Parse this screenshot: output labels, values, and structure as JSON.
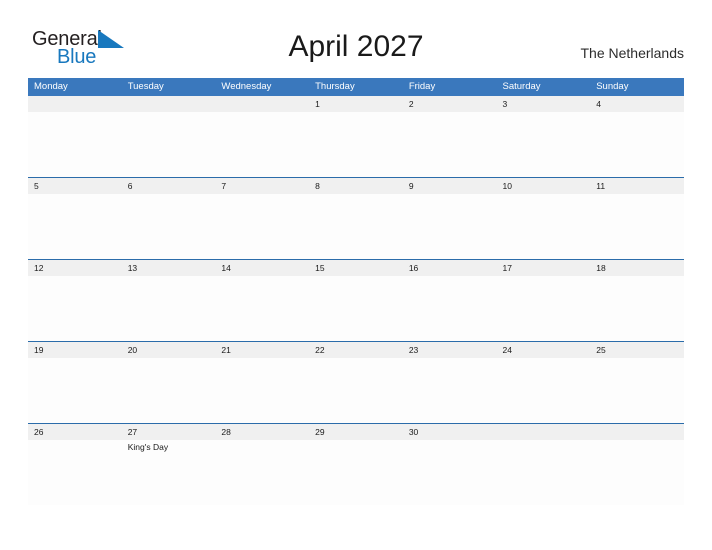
{
  "brand": {
    "name_part1": "General",
    "name_part2": "Blue",
    "flag_icon": "blue-triangle-flag",
    "dark_color": "#231f20",
    "blue_color": "#1878be"
  },
  "header": {
    "title": "April 2027",
    "country": "The Netherlands"
  },
  "theme": {
    "header_blue": "#3a78bd",
    "row_line_blue": "#2b6caa",
    "date_band_gray": "#f0f0f0",
    "page_background": "#ffffff"
  },
  "calendar": {
    "month": "April",
    "year": "2027",
    "week_start": "Monday",
    "weekdays": [
      "Monday",
      "Tuesday",
      "Wednesday",
      "Thursday",
      "Friday",
      "Saturday",
      "Sunday"
    ],
    "weeks": [
      {
        "days": [
          {
            "date": "",
            "event": ""
          },
          {
            "date": "",
            "event": ""
          },
          {
            "date": "",
            "event": ""
          },
          {
            "date": "1",
            "event": ""
          },
          {
            "date": "2",
            "event": ""
          },
          {
            "date": "3",
            "event": ""
          },
          {
            "date": "4",
            "event": ""
          }
        ]
      },
      {
        "days": [
          {
            "date": "5",
            "event": ""
          },
          {
            "date": "6",
            "event": ""
          },
          {
            "date": "7",
            "event": ""
          },
          {
            "date": "8",
            "event": ""
          },
          {
            "date": "9",
            "event": ""
          },
          {
            "date": "10",
            "event": ""
          },
          {
            "date": "11",
            "event": ""
          }
        ]
      },
      {
        "days": [
          {
            "date": "12",
            "event": ""
          },
          {
            "date": "13",
            "event": ""
          },
          {
            "date": "14",
            "event": ""
          },
          {
            "date": "15",
            "event": ""
          },
          {
            "date": "16",
            "event": ""
          },
          {
            "date": "17",
            "event": ""
          },
          {
            "date": "18",
            "event": ""
          }
        ]
      },
      {
        "days": [
          {
            "date": "19",
            "event": ""
          },
          {
            "date": "20",
            "event": ""
          },
          {
            "date": "21",
            "event": ""
          },
          {
            "date": "22",
            "event": ""
          },
          {
            "date": "23",
            "event": ""
          },
          {
            "date": "24",
            "event": ""
          },
          {
            "date": "25",
            "event": ""
          }
        ]
      },
      {
        "days": [
          {
            "date": "26",
            "event": ""
          },
          {
            "date": "27",
            "event": "King's Day"
          },
          {
            "date": "28",
            "event": ""
          },
          {
            "date": "29",
            "event": ""
          },
          {
            "date": "30",
            "event": ""
          },
          {
            "date": "",
            "event": ""
          },
          {
            "date": "",
            "event": ""
          }
        ]
      }
    ]
  }
}
